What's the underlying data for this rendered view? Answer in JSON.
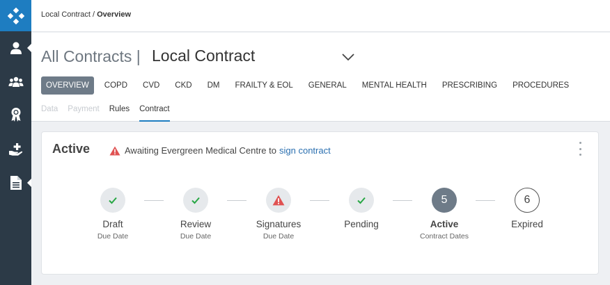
{
  "colors": {
    "sidebar_bg": "#2c3a47",
    "logo_bg": "#1e7dc1",
    "active_tab_bg": "#6e7b88",
    "link": "#2a6fb0",
    "warning": "#e05252",
    "success": "#28a745"
  },
  "sidebar": {
    "items": [
      {
        "name": "user-icon"
      },
      {
        "name": "group-icon"
      },
      {
        "name": "award-icon"
      },
      {
        "name": "hand-plus-icon"
      },
      {
        "name": "document-icon"
      }
    ]
  },
  "breadcrumb": {
    "parent": "Local Contract / ",
    "current": "Overview"
  },
  "header": {
    "title_prefix": "All Contracts |",
    "title_selected": "Local Contract"
  },
  "tabs": [
    {
      "label": "OVERVIEW"
    },
    {
      "label": "COPD"
    },
    {
      "label": "CVD"
    },
    {
      "label": "CKD"
    },
    {
      "label": "DM"
    },
    {
      "label": "FRAILTY & EOL"
    },
    {
      "label": "GENERAL"
    },
    {
      "label": "MENTAL HEALTH"
    },
    {
      "label": "PRESCRIBING"
    },
    {
      "label": "PROCEDURES"
    }
  ],
  "subtabs": [
    {
      "label": "Data"
    },
    {
      "label": "Payment"
    },
    {
      "label": "Rules"
    },
    {
      "label": "Contract"
    }
  ],
  "card": {
    "status": "Active",
    "alert_text": "Awaiting Evergreen Medical Centre to",
    "alert_link": "sign contract"
  },
  "steps": [
    {
      "label": "Draft",
      "sub": "Due Date"
    },
    {
      "label": "Review",
      "sub": "Due Date"
    },
    {
      "label": "Signatures",
      "sub": "Due Date"
    },
    {
      "label": "Pending",
      "sub": ""
    },
    {
      "label": "Active",
      "sub": "Contract Dates",
      "number": "5"
    },
    {
      "label": "Expired",
      "sub": "",
      "number": "6"
    }
  ]
}
